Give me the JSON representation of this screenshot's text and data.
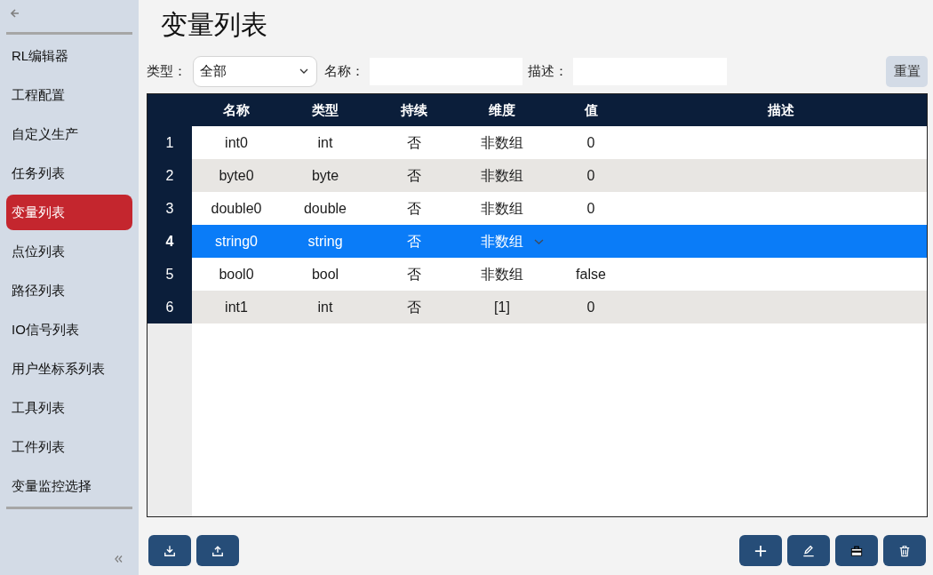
{
  "sidebar": {
    "items": [
      {
        "label": "RL编辑器",
        "selected": false
      },
      {
        "label": "工程配置",
        "selected": false
      },
      {
        "label": "自定义生产",
        "selected": false
      },
      {
        "label": "任务列表",
        "selected": false
      },
      {
        "label": "变量列表",
        "selected": true
      },
      {
        "label": "点位列表",
        "selected": false
      },
      {
        "label": "路径列表",
        "selected": false
      },
      {
        "label": "IO信号列表",
        "selected": false
      },
      {
        "label": "用户坐标系列表",
        "selected": false
      },
      {
        "label": "工具列表",
        "selected": false
      },
      {
        "label": "工件列表",
        "selected": false
      },
      {
        "label": "变量监控选择",
        "selected": false
      }
    ]
  },
  "page_title": "变量列表",
  "filters": {
    "type": {
      "label": "类型：",
      "value": "全部"
    },
    "name": {
      "label": "名称："
    },
    "description": {
      "label": "描述："
    },
    "reset_button": "重置"
  },
  "table": {
    "columns": [
      "名称",
      "类型",
      "持续",
      "维度",
      "值",
      "描述"
    ],
    "rows": [
      {
        "index": "1",
        "cells": [
          "int0",
          "int",
          "否",
          "非数组",
          "0",
          ""
        ],
        "selected": false
      },
      {
        "index": "2",
        "cells": [
          "byte0",
          "byte",
          "否",
          "非数组",
          "0",
          ""
        ],
        "selected": false
      },
      {
        "index": "3",
        "cells": [
          "double0",
          "double",
          "否",
          "非数组",
          "0",
          ""
        ],
        "selected": false
      },
      {
        "index": "4",
        "cells": [
          "string0",
          "string",
          "否",
          "非数组",
          "",
          ""
        ],
        "selected": true
      },
      {
        "index": "5",
        "cells": [
          "bool0",
          "bool",
          "否",
          "非数组",
          "false",
          ""
        ],
        "selected": false
      },
      {
        "index": "6",
        "cells": [
          "int1",
          "int",
          "否",
          "[1]",
          "0",
          ""
        ],
        "selected": false
      }
    ]
  },
  "toolbar": {
    "left": [
      {
        "kind": "import"
      },
      {
        "kind": "export"
      }
    ],
    "right": [
      {
        "kind": "add"
      },
      {
        "kind": "edit"
      },
      {
        "kind": "clear"
      },
      {
        "kind": "delete"
      }
    ]
  }
}
